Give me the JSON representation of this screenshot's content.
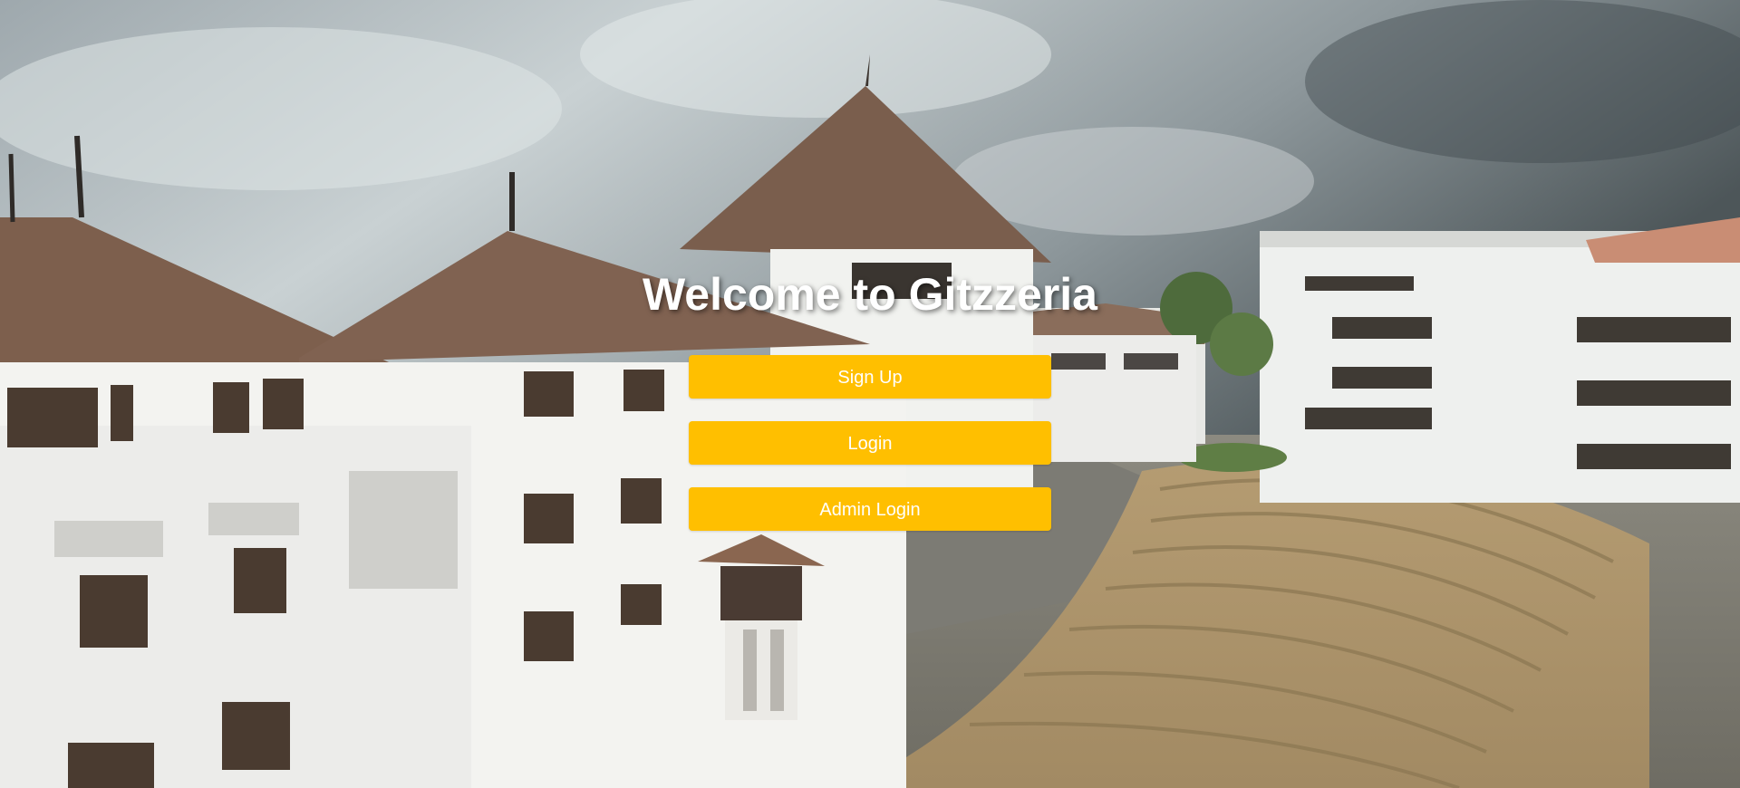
{
  "page": {
    "title": "Welcome to Gitzzeria"
  },
  "buttons": {
    "signup_label": "Sign Up",
    "login_label": "Login",
    "admin_login_label": "Admin Login"
  },
  "colors": {
    "button_bg": "#ffbf00",
    "button_text": "#ffffff",
    "title_text": "#ffffff"
  }
}
